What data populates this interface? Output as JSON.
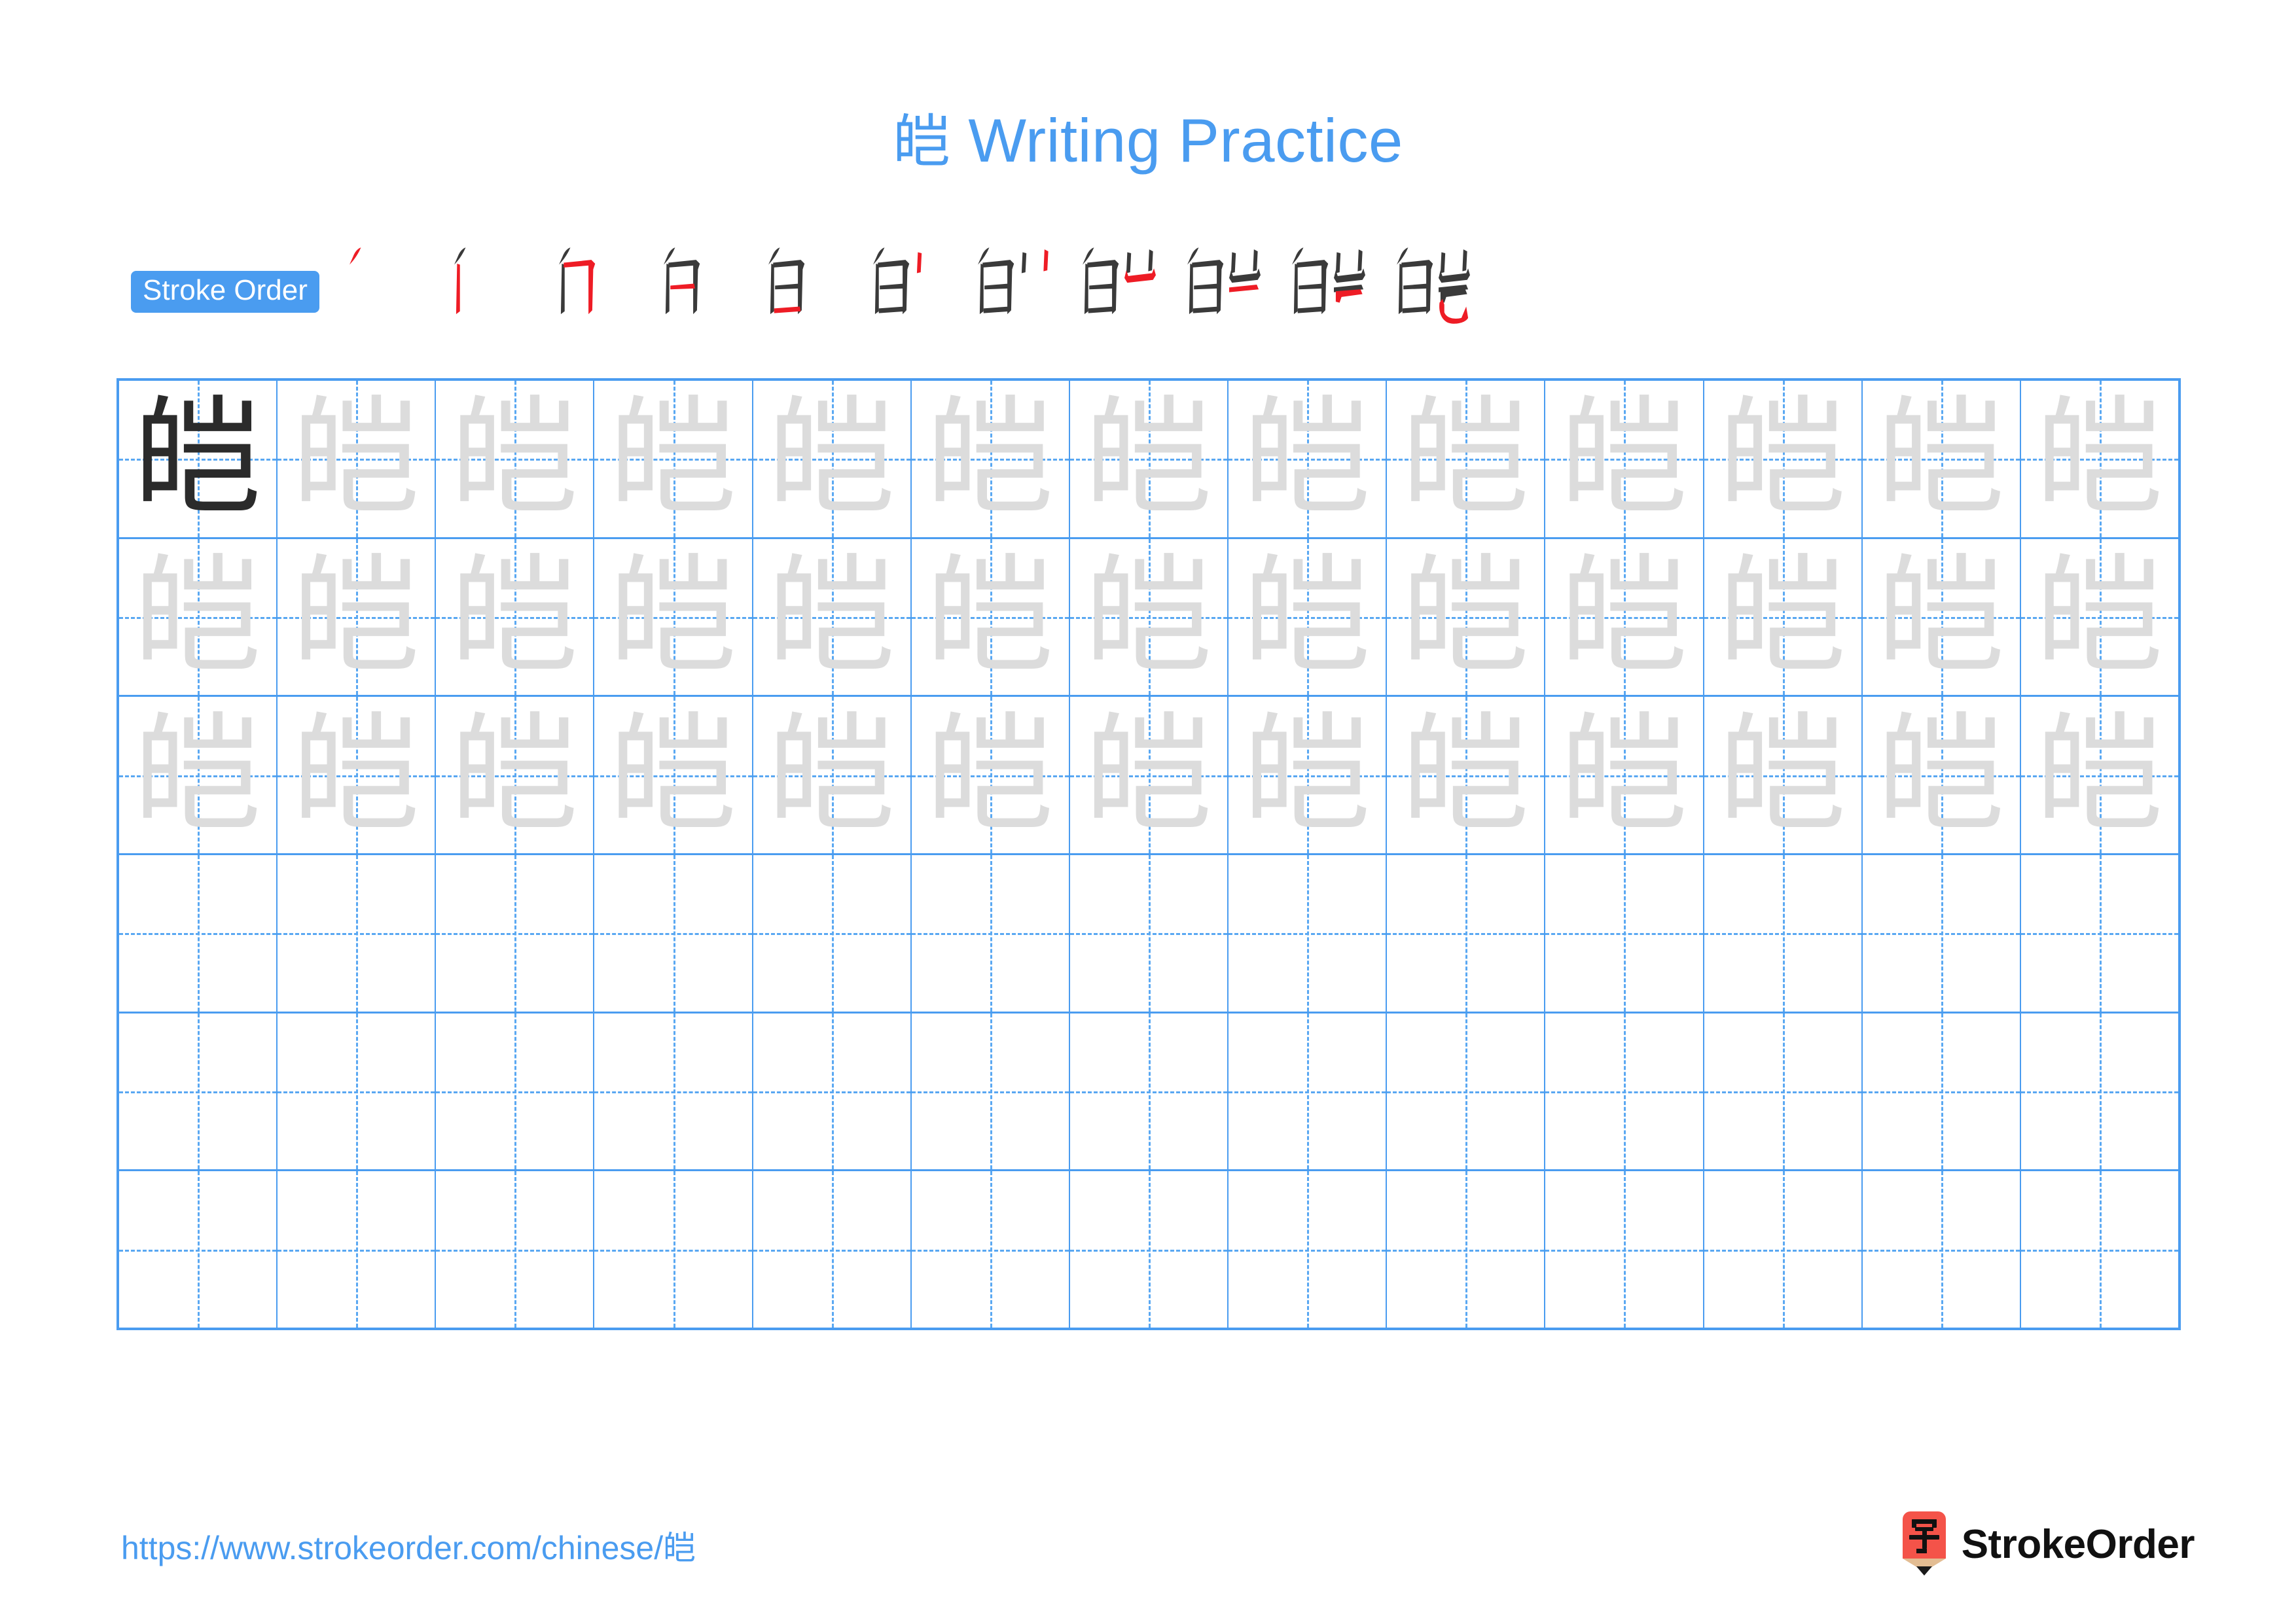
{
  "character": "皑",
  "colors": {
    "accent_blue": "#4a9cf0",
    "grid_line": "#4a9cf0",
    "guide_line": "#5aa8f2",
    "trace_gray": "#dcdcdc",
    "solid_char": "#2b2b2b",
    "stroke_new": "#ee1c25",
    "stroke_done": "#3a3a3a",
    "logo_red": "#f45349",
    "logo_wood": "#e3bd93",
    "logo_tip": "#1a1a1a",
    "brand_text": "#111111"
  },
  "header": {
    "title_char": "皑",
    "title_text": " Writing Practice"
  },
  "stroke_order": {
    "badge_label": "Stroke Order",
    "stroke_count": 11,
    "steps": [
      {
        "index": 1,
        "new_stroke": "丿 (pie) top-left downward slant"
      },
      {
        "index": 2,
        "new_stroke": "丨 (shu) left vertical of 白"
      },
      {
        "index": 3,
        "new_stroke": "𠃍 (hengzhe) top-right corner of 白"
      },
      {
        "index": 4,
        "new_stroke": "一 (heng) middle horizontal of 白"
      },
      {
        "index": 5,
        "new_stroke": "一 (heng) bottom horizontal closing 白"
      },
      {
        "index": 6,
        "new_stroke": "丨 (shu) left short vertical of 岂 top"
      },
      {
        "index": 7,
        "new_stroke": "丨 (shu) right short vertical of 岂 top"
      },
      {
        "index": 8,
        "new_stroke": "㇄ (shuzhe) base of 山 component"
      },
      {
        "index": 9,
        "new_stroke": "一 (heng) horizontal of 己"
      },
      {
        "index": 10,
        "new_stroke": "𠃌 (hengzhe) upper fold of 己"
      },
      {
        "index": 11,
        "new_stroke": "乚 (shuwangou) final hook of 己"
      }
    ]
  },
  "practice_grid": {
    "columns": 13,
    "rows": 6,
    "rows_data": [
      {
        "row": 1,
        "cells": [
          "皑",
          "皑",
          "皑",
          "皑",
          "皑",
          "皑",
          "皑",
          "皑",
          "皑",
          "皑",
          "皑",
          "皑",
          "皑"
        ],
        "first_cell_dark": true
      },
      {
        "row": 2,
        "cells": [
          "皑",
          "皑",
          "皑",
          "皑",
          "皑",
          "皑",
          "皑",
          "皑",
          "皑",
          "皑",
          "皑",
          "皑",
          "皑"
        ],
        "first_cell_dark": false
      },
      {
        "row": 3,
        "cells": [
          "皑",
          "皑",
          "皑",
          "皑",
          "皑",
          "皑",
          "皑",
          "皑",
          "皑",
          "皑",
          "皑",
          "皑",
          "皑"
        ],
        "first_cell_dark": false
      },
      {
        "row": 4,
        "cells": [
          "",
          "",
          "",
          "",
          "",
          "",
          "",
          "",
          "",
          "",
          "",
          "",
          ""
        ],
        "first_cell_dark": false
      },
      {
        "row": 5,
        "cells": [
          "",
          "",
          "",
          "",
          "",
          "",
          "",
          "",
          "",
          "",
          "",
          "",
          ""
        ],
        "first_cell_dark": false
      },
      {
        "row": 6,
        "cells": [
          "",
          "",
          "",
          "",
          "",
          "",
          "",
          "",
          "",
          "",
          "",
          "",
          ""
        ],
        "first_cell_dark": false
      }
    ]
  },
  "footer": {
    "url": "https://www.strokeorder.com/chinese/皑",
    "brand_name": "StrokeOrder",
    "brand_icon_char": "字"
  }
}
